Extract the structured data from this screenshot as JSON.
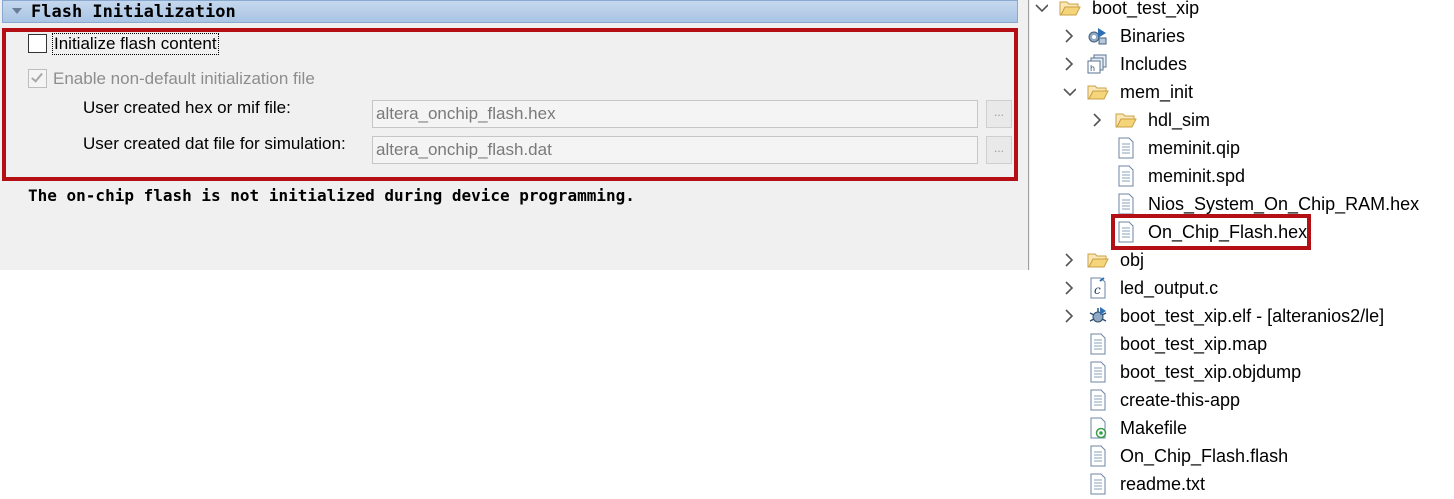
{
  "left_panel": {
    "section_title": "Flash Initialization",
    "initialize_checkbox_label": "Initialize flash content",
    "initialize_checked": false,
    "enable_nondefault_label": "Enable non-default initialization file",
    "enable_nondefault_checked": true,
    "hex_label": "User created hex or mif file:",
    "hex_value": "altera_onchip_flash.hex",
    "dat_label": "User created dat file for simulation:",
    "dat_value": "altera_onchip_flash.dat",
    "browse_label": "...",
    "status_message": "The on-chip flash is not initialized during device programming.",
    "highlight_color": "#b40f14"
  },
  "tree": {
    "items": [
      {
        "label": "boot_test_xip",
        "icon": "open-project-folder-icon",
        "expander": "expanded"
      },
      {
        "label": "Binaries",
        "icon": "binaries-icon",
        "expander": "collapsed"
      },
      {
        "label": "Includes",
        "icon": "includes-icon",
        "expander": "collapsed"
      },
      {
        "label": "mem_init",
        "icon": "open-folder-icon",
        "expander": "expanded"
      },
      {
        "label": "hdl_sim",
        "icon": "folder-icon",
        "expander": "collapsed"
      },
      {
        "label": "meminit.qip",
        "icon": "file-icon",
        "expander": "none",
        "selected": true
      },
      {
        "label": "meminit.spd",
        "icon": "file-icon",
        "expander": "none"
      },
      {
        "label": "Nios_System_On_Chip_RAM.hex",
        "icon": "file-icon",
        "expander": "none"
      },
      {
        "label": "On_Chip_Flash.hex",
        "icon": "file-icon",
        "expander": "none",
        "highlighted": true
      },
      {
        "label": "obj",
        "icon": "folder-icon",
        "expander": "collapsed"
      },
      {
        "label": "led_output.c",
        "icon": "c-source-file-icon",
        "expander": "collapsed"
      },
      {
        "label": "boot_test_xip.elf - [alteranios2/le]",
        "icon": "binary-bug-icon",
        "expander": "collapsed"
      },
      {
        "label": "boot_test_xip.map",
        "icon": "file-icon",
        "expander": "none"
      },
      {
        "label": "boot_test_xip.objdump",
        "icon": "file-icon",
        "expander": "none"
      },
      {
        "label": "create-this-app",
        "icon": "file-icon",
        "expander": "none"
      },
      {
        "label": "Makefile",
        "icon": "makefile-icon",
        "expander": "none"
      },
      {
        "label": "On_Chip_Flash.flash",
        "icon": "file-icon",
        "expander": "none"
      },
      {
        "label": "readme.txt",
        "icon": "file-icon",
        "expander": "none"
      }
    ]
  }
}
